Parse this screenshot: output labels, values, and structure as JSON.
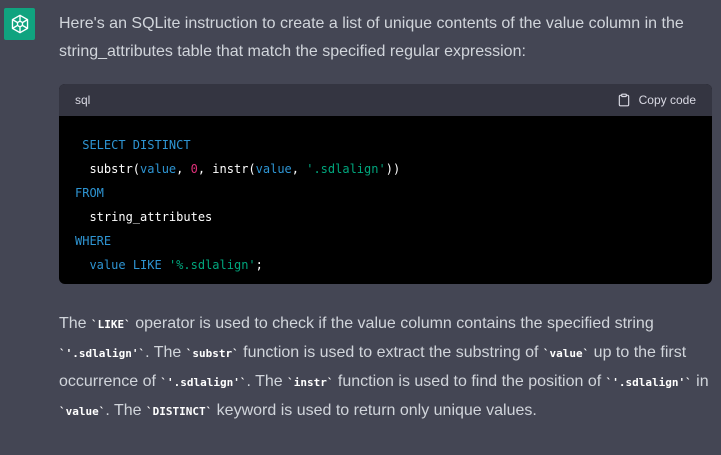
{
  "assistant": {
    "icon": "openai-logo-icon"
  },
  "intro_text": "Here's an SQLite instruction to create a list of unique contents of the value column in the string_attributes table that match the specified regular expression:",
  "code": {
    "language": "sql",
    "copy_label": "Copy code",
    "tokens": {
      "select_distinct": "SELECT DISTINCT",
      "substr": "substr(",
      "value1": "value",
      "comma1": ", ",
      "zero": "0",
      "comma2": ", ",
      "instr": "instr(",
      "value2": "value",
      "comma3": ", ",
      "str1": "'.sdlalign'",
      "close": "))",
      "from": "FROM",
      "table": "string_attributes",
      "where": "WHERE",
      "value3": "value",
      "like": "LIKE",
      "str2": "'%.sdlalign'",
      "semicolon": ";"
    }
  },
  "explanation": {
    "t1": "The ",
    "c1": "`LIKE`",
    "t2": " operator is used to check if the value column contains the specified string ",
    "c2": "`'.sdlalign'`",
    "t3": ". The ",
    "c3": "`substr`",
    "t4": " function is used to extract the substring of ",
    "c4": "`value`",
    "t5": " up to the first occurrence of ",
    "c5": "`'.sdlalign'`",
    "t6": ". The ",
    "c6": "`instr`",
    "t7": " function is used to find the position of ",
    "c7": "`'.sdlalign'`",
    "t8": " in ",
    "c8": "`value`",
    "t9": ". The ",
    "c9": "`DISTINCT`",
    "t10": " keyword is used to return only unique values."
  },
  "colors": {
    "background": "#444654",
    "accent": "#10a37f",
    "code_bg": "#000000",
    "keyword": "#2e95d3",
    "number": "#df3079",
    "string": "#00a67d"
  }
}
